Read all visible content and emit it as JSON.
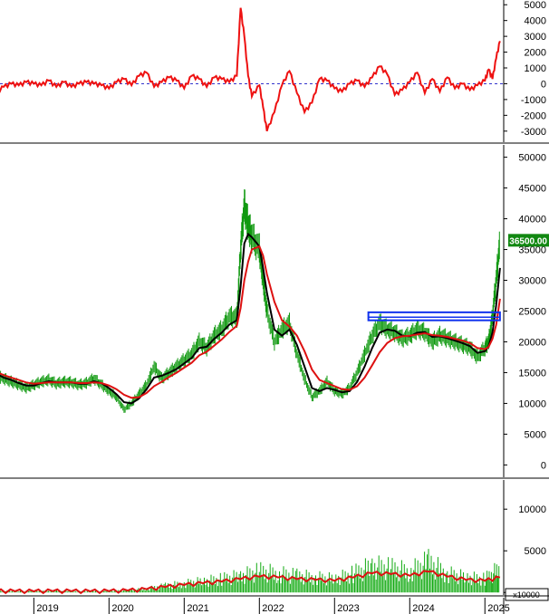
{
  "chart_data": [
    {
      "type": "line",
      "panel": "oscillator",
      "y_ticks": [
        -3000,
        -2000,
        -1000,
        0,
        1000,
        2000,
        3000,
        4000,
        5000
      ],
      "ylim": [
        -3700,
        5300
      ],
      "zero_line": {
        "value": 0,
        "color": "#3333cc",
        "style": "dashed"
      },
      "x": [
        2018.0,
        2018.1,
        2018.2,
        2018.3,
        2018.4,
        2018.5,
        2018.6,
        2018.7,
        2018.8,
        2018.9,
        2019.0,
        2019.1,
        2019.2,
        2019.3,
        2019.4,
        2019.5,
        2019.6,
        2019.7,
        2019.8,
        2019.9,
        2020.0,
        2020.1,
        2020.2,
        2020.3,
        2020.4,
        2020.5,
        2020.6,
        2020.7,
        2020.8,
        2020.9,
        2021.0,
        2021.1,
        2021.2,
        2021.3,
        2021.4,
        2021.5,
        2021.6,
        2021.7,
        2021.75,
        2021.8,
        2021.85,
        2021.9,
        2022.0,
        2022.05,
        2022.1,
        2022.2,
        2022.3,
        2022.4,
        2022.5,
        2022.6,
        2022.7,
        2022.8,
        2022.9,
        2023.0,
        2023.1,
        2023.2,
        2023.3,
        2023.4,
        2023.5,
        2023.6,
        2023.7,
        2023.8,
        2023.9,
        2024.0,
        2024.1,
        2024.2,
        2024.3,
        2024.4,
        2024.5,
        2024.6,
        2024.7,
        2024.8,
        2024.9,
        2025.0,
        2025.05,
        2025.1,
        2025.15,
        2025.2
      ],
      "series": [
        {
          "color": "#ee1111",
          "values": [
            100,
            300,
            -200,
            -400,
            -100,
            -500,
            -200,
            0,
            -100,
            100,
            0,
            -100,
            200,
            -200,
            100,
            -200,
            0,
            100,
            0,
            -100,
            -300,
            100,
            300,
            -100,
            500,
            700,
            -200,
            100,
            400,
            200,
            -300,
            500,
            300,
            -200,
            400,
            300,
            100,
            500,
            4800,
            3000,
            500,
            -800,
            -100,
            -1500,
            -3000,
            -1800,
            -100,
            800,
            -600,
            -1800,
            -1200,
            300,
            200,
            -300,
            -500,
            0,
            200,
            -200,
            400,
            1100,
            600,
            -700,
            -400,
            100,
            700,
            -600,
            300,
            -500,
            400,
            -300,
            0,
            -400,
            -100,
            200,
            900,
            300,
            1600,
            2700
          ]
        }
      ]
    },
    {
      "type": "line",
      "panel": "price",
      "y_ticks": [
        0,
        5000,
        10000,
        15000,
        20000,
        25000,
        30000,
        35000,
        40000,
        45000,
        50000
      ],
      "ylim": [
        -2000,
        52000
      ],
      "last_price_label": "36500.00",
      "box": {
        "x0": 2023.45,
        "x1": 2025.2,
        "y0": 23500,
        "y1": 24800,
        "color": "#1133ee"
      },
      "x": [
        2018.0,
        2018.1,
        2018.2,
        2018.3,
        2018.4,
        2018.5,
        2018.6,
        2018.7,
        2018.8,
        2018.9,
        2019.0,
        2019.1,
        2019.2,
        2019.3,
        2019.4,
        2019.5,
        2019.6,
        2019.7,
        2019.8,
        2019.9,
        2020.0,
        2020.1,
        2020.2,
        2020.3,
        2020.4,
        2020.5,
        2020.6,
        2020.7,
        2020.8,
        2020.9,
        2021.0,
        2021.1,
        2021.2,
        2021.3,
        2021.4,
        2021.5,
        2021.6,
        2021.7,
        2021.75,
        2021.8,
        2021.85,
        2021.9,
        2022.0,
        2022.05,
        2022.1,
        2022.2,
        2022.3,
        2022.4,
        2022.5,
        2022.6,
        2022.7,
        2022.8,
        2022.9,
        2023.0,
        2023.1,
        2023.2,
        2023.3,
        2023.4,
        2023.5,
        2023.6,
        2023.7,
        2023.8,
        2023.9,
        2024.0,
        2024.1,
        2024.2,
        2024.3,
        2024.4,
        2024.5,
        2024.6,
        2024.7,
        2024.8,
        2024.9,
        2025.0,
        2025.05,
        2025.1,
        2025.15,
        2025.2
      ],
      "series": [
        {
          "name": "",
          "color": "#119911",
          "values": [
            16000,
            16500,
            17000,
            16000,
            15000,
            14500,
            14000,
            13500,
            13000,
            12500,
            13000,
            13500,
            13800,
            13200,
            13500,
            13400,
            13000,
            13300,
            14000,
            13000,
            12000,
            11000,
            9000,
            10000,
            11500,
            13000,
            16000,
            14000,
            15000,
            16000,
            17000,
            18000,
            20000,
            19000,
            21000,
            22000,
            24000,
            24000,
            35000,
            42000,
            39000,
            37000,
            35000,
            30000,
            25000,
            20000,
            22000,
            23000,
            18000,
            14000,
            11000,
            12000,
            13500,
            12000,
            11500,
            12500,
            15000,
            18000,
            21000,
            23000,
            22000,
            21500,
            20500,
            21000,
            22000,
            21500,
            20000,
            21000,
            20500,
            20000,
            19500,
            19000,
            17500,
            19000,
            20000,
            24000,
            30000,
            36500
          ]
        },
        {
          "name": "",
          "color": "#000000",
          "values": [
            15800,
            16200,
            16500,
            16200,
            15300,
            14800,
            14200,
            13800,
            13300,
            12900,
            12900,
            13300,
            13600,
            13400,
            13400,
            13400,
            13200,
            13200,
            13600,
            13300,
            12500,
            11500,
            10200,
            10000,
            10800,
            12300,
            14200,
            14500,
            15000,
            15600,
            16500,
            17400,
            19000,
            19200,
            20500,
            21500,
            22800,
            23500,
            29000,
            36000,
            37500,
            37000,
            35500,
            32000,
            28000,
            22000,
            21000,
            22000,
            19500,
            16000,
            12500,
            12000,
            12500,
            12200,
            11800,
            12000,
            13500,
            16000,
            19000,
            21500,
            22000,
            21800,
            21000,
            20900,
            21500,
            21600,
            20800,
            20900,
            20600,
            20200,
            19800,
            19300,
            18200,
            18500,
            19300,
            21500,
            26000,
            32000
          ]
        },
        {
          "name": "",
          "color": "#dd1111",
          "values": [
            15500,
            15800,
            16100,
            16000,
            15600,
            15100,
            14600,
            14200,
            13800,
            13400,
            13200,
            13300,
            13400,
            13400,
            13400,
            13400,
            13300,
            13300,
            13400,
            13300,
            12900,
            12300,
            11400,
            10900,
            11000,
            11700,
            12800,
            13500,
            14300,
            15000,
            15800,
            16600,
            17800,
            18400,
            19400,
            20400,
            21600,
            22600,
            25500,
            30000,
            33000,
            35000,
            35500,
            34000,
            31000,
            26500,
            23500,
            22500,
            21000,
            18500,
            15500,
            13800,
            13300,
            12800,
            12300,
            12200,
            12800,
            14200,
            16200,
            18300,
            19800,
            20600,
            20900,
            21000,
            21200,
            21400,
            21100,
            21000,
            20800,
            20500,
            20200,
            19800,
            19000,
            18800,
            19200,
            20500,
            22800,
            27000
          ]
        }
      ]
    },
    {
      "type": "bar",
      "panel": "volume",
      "y_ticks": [
        0,
        5000,
        10000
      ],
      "ylim": [
        -300,
        13500
      ],
      "scale_label": "x10000",
      "x": [
        2018.0,
        2018.25,
        2018.5,
        2018.75,
        2019.0,
        2019.25,
        2019.5,
        2019.75,
        2020.0,
        2020.25,
        2020.5,
        2020.75,
        2021.0,
        2021.25,
        2021.5,
        2021.75,
        2022.0,
        2022.25,
        2022.5,
        2022.75,
        2023.0,
        2023.25,
        2023.5,
        2023.75,
        2024.0,
        2024.25,
        2024.5,
        2024.75,
        2025.0,
        2025.2
      ],
      "series": [
        {
          "name": "",
          "color": "#11aa11",
          "values": [
            200,
            250,
            200,
            150,
            150,
            200,
            150,
            150,
            200,
            300,
            500,
            900,
            1200,
            1500,
            1800,
            2200,
            2800,
            2500,
            2200,
            2000,
            1800,
            2500,
            3500,
            3200,
            2800,
            4000,
            2500,
            2000,
            1800,
            3200
          ]
        },
        {
          "name": "",
          "color": "#dd1111",
          "values": [
            150,
            180,
            170,
            150,
            140,
            160,
            150,
            140,
            160,
            220,
            380,
            650,
            900,
            1100,
            1300,
            1600,
            1900,
            1800,
            1600,
            1500,
            1400,
            1800,
            2300,
            2200,
            2000,
            2500,
            1900,
            1500,
            1400,
            1800
          ]
        }
      ]
    },
    {
      "type": "axis",
      "panel": "time",
      "xlim": [
        2018.55,
        2025.25
      ],
      "tick_labels": [
        "2019",
        "2020",
        "2021",
        "2022",
        "2023",
        "2024",
        "2025"
      ],
      "tick_values": [
        2019.0,
        2020.0,
        2021.0,
        2022.0,
        2023.0,
        2024.0,
        2025.0
      ]
    }
  ]
}
